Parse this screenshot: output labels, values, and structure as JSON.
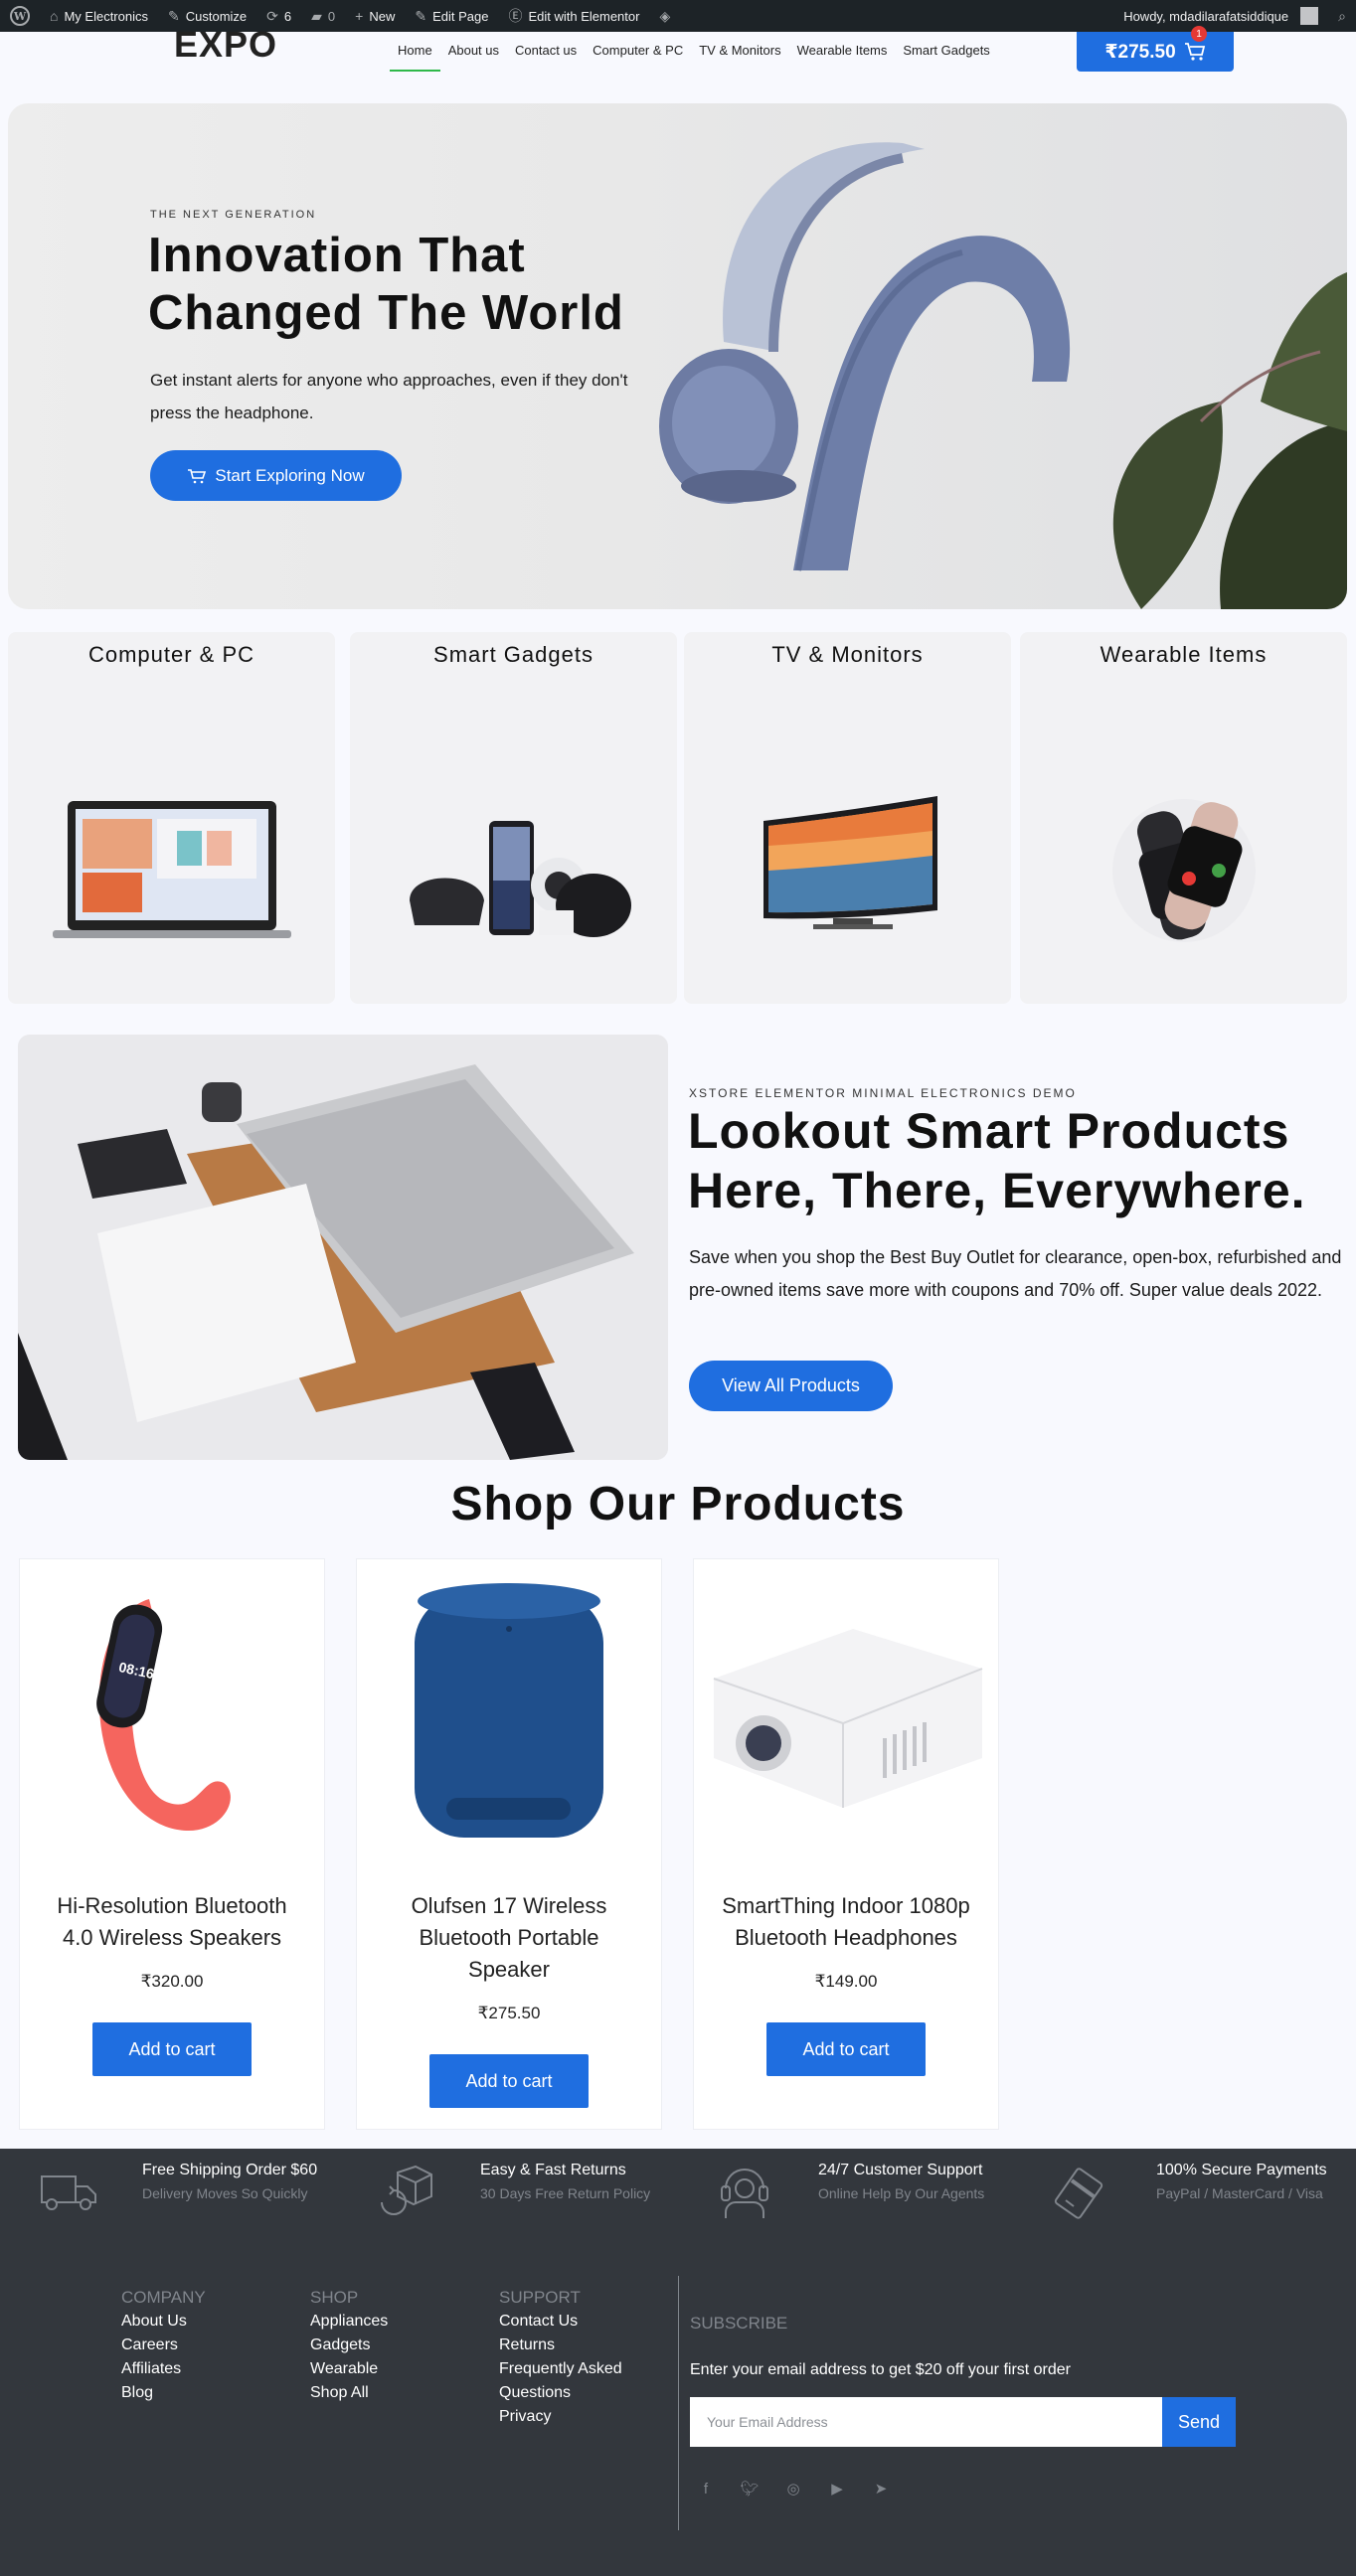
{
  "adminbar": {
    "site_name": "My Electronics",
    "customize": "Customize",
    "updates_count": "6",
    "comments_count": "0",
    "new": "New",
    "edit_page": "Edit Page",
    "edit_elementor": "Edit with Elementor",
    "howdy": "Howdy, mdadilarafatsiddique"
  },
  "header": {
    "logo": "EXPO",
    "nav": [
      "Home",
      "About us",
      "Contact us",
      "Computer & PC",
      "TV & Monitors",
      "Wearable Items",
      "Smart Gadgets"
    ],
    "cart_total": "₹275.50",
    "cart_count": "1"
  },
  "hero": {
    "eyebrow": "THE NEXT GENERATION",
    "title": "Innovation That Changed The World",
    "text": "Get instant alerts for anyone who approaches, even if they don't press the headphone.",
    "button": "Start Exploring Now"
  },
  "categories": [
    "Computer & PC",
    "Smart Gadgets",
    "TV & Monitors",
    "Wearable Items"
  ],
  "promo": {
    "eyebrow": "XSTORE ELEMENTOR MINIMAL ELECTRONICS DEMO",
    "title": "Lookout Smart Products Here, There, Everywhere.",
    "text": "Save when you shop the Best Buy Outlet for clearance, open-box, refurbished and pre-owned items save more with coupons and 70% off. Super value deals 2022.",
    "button": "View All Products"
  },
  "shop": {
    "title": "Shop Our Products",
    "products": [
      {
        "name": "Hi-Resolution Bluetooth 4.0 Wireless Speakers",
        "price": "₹320.00",
        "button": "Add to cart"
      },
      {
        "name": "Olufsen 17 Wireless Bluetooth Portable Speaker",
        "price": "₹275.50",
        "button": "Add to cart"
      },
      {
        "name": "SmartThing Indoor 1080p Bluetooth Headphones",
        "price": "₹149.00",
        "button": "Add to cart"
      }
    ]
  },
  "features": [
    {
      "title": "Free Shipping Order $60",
      "sub": "Delivery Moves So Quickly",
      "icon": "truck-icon"
    },
    {
      "title": "Easy & Fast Returns",
      "sub": "30 Days Free Return Policy",
      "icon": "return-box-icon"
    },
    {
      "title": "24/7 Customer Support",
      "sub": "Online Help By Our Agents",
      "icon": "headset-icon"
    },
    {
      "title": "100% Secure Payments",
      "sub": "PayPal / MasterCard / Visa",
      "icon": "credit-card-icon"
    }
  ],
  "footer": {
    "company": {
      "head": "COMPANY",
      "links": [
        "About Us",
        "Careers",
        "Affiliates",
        "Blog"
      ]
    },
    "shop": {
      "head": "SHOP",
      "links": [
        "Appliances",
        "Gadgets",
        "Wearable",
        "Shop All"
      ]
    },
    "support": {
      "head": "SUPPORT",
      "links": [
        "Contact Us",
        "Returns",
        "Frequently Asked",
        "Questions",
        "Privacy"
      ]
    },
    "subscribe": {
      "head": "SUBSCRIBE",
      "text": "Enter your email address to get $20 off your first order",
      "placeholder": "Your Email Address",
      "button": "Send"
    },
    "social": [
      "facebook-icon",
      "twitter-icon",
      "instagram-icon",
      "youtube-icon",
      "telegram-icon"
    ]
  },
  "colors": {
    "accent": "#1f6ee0",
    "footer_bg": "#33373d",
    "nav_active": "#2fb94a",
    "badge": "#e53935"
  }
}
